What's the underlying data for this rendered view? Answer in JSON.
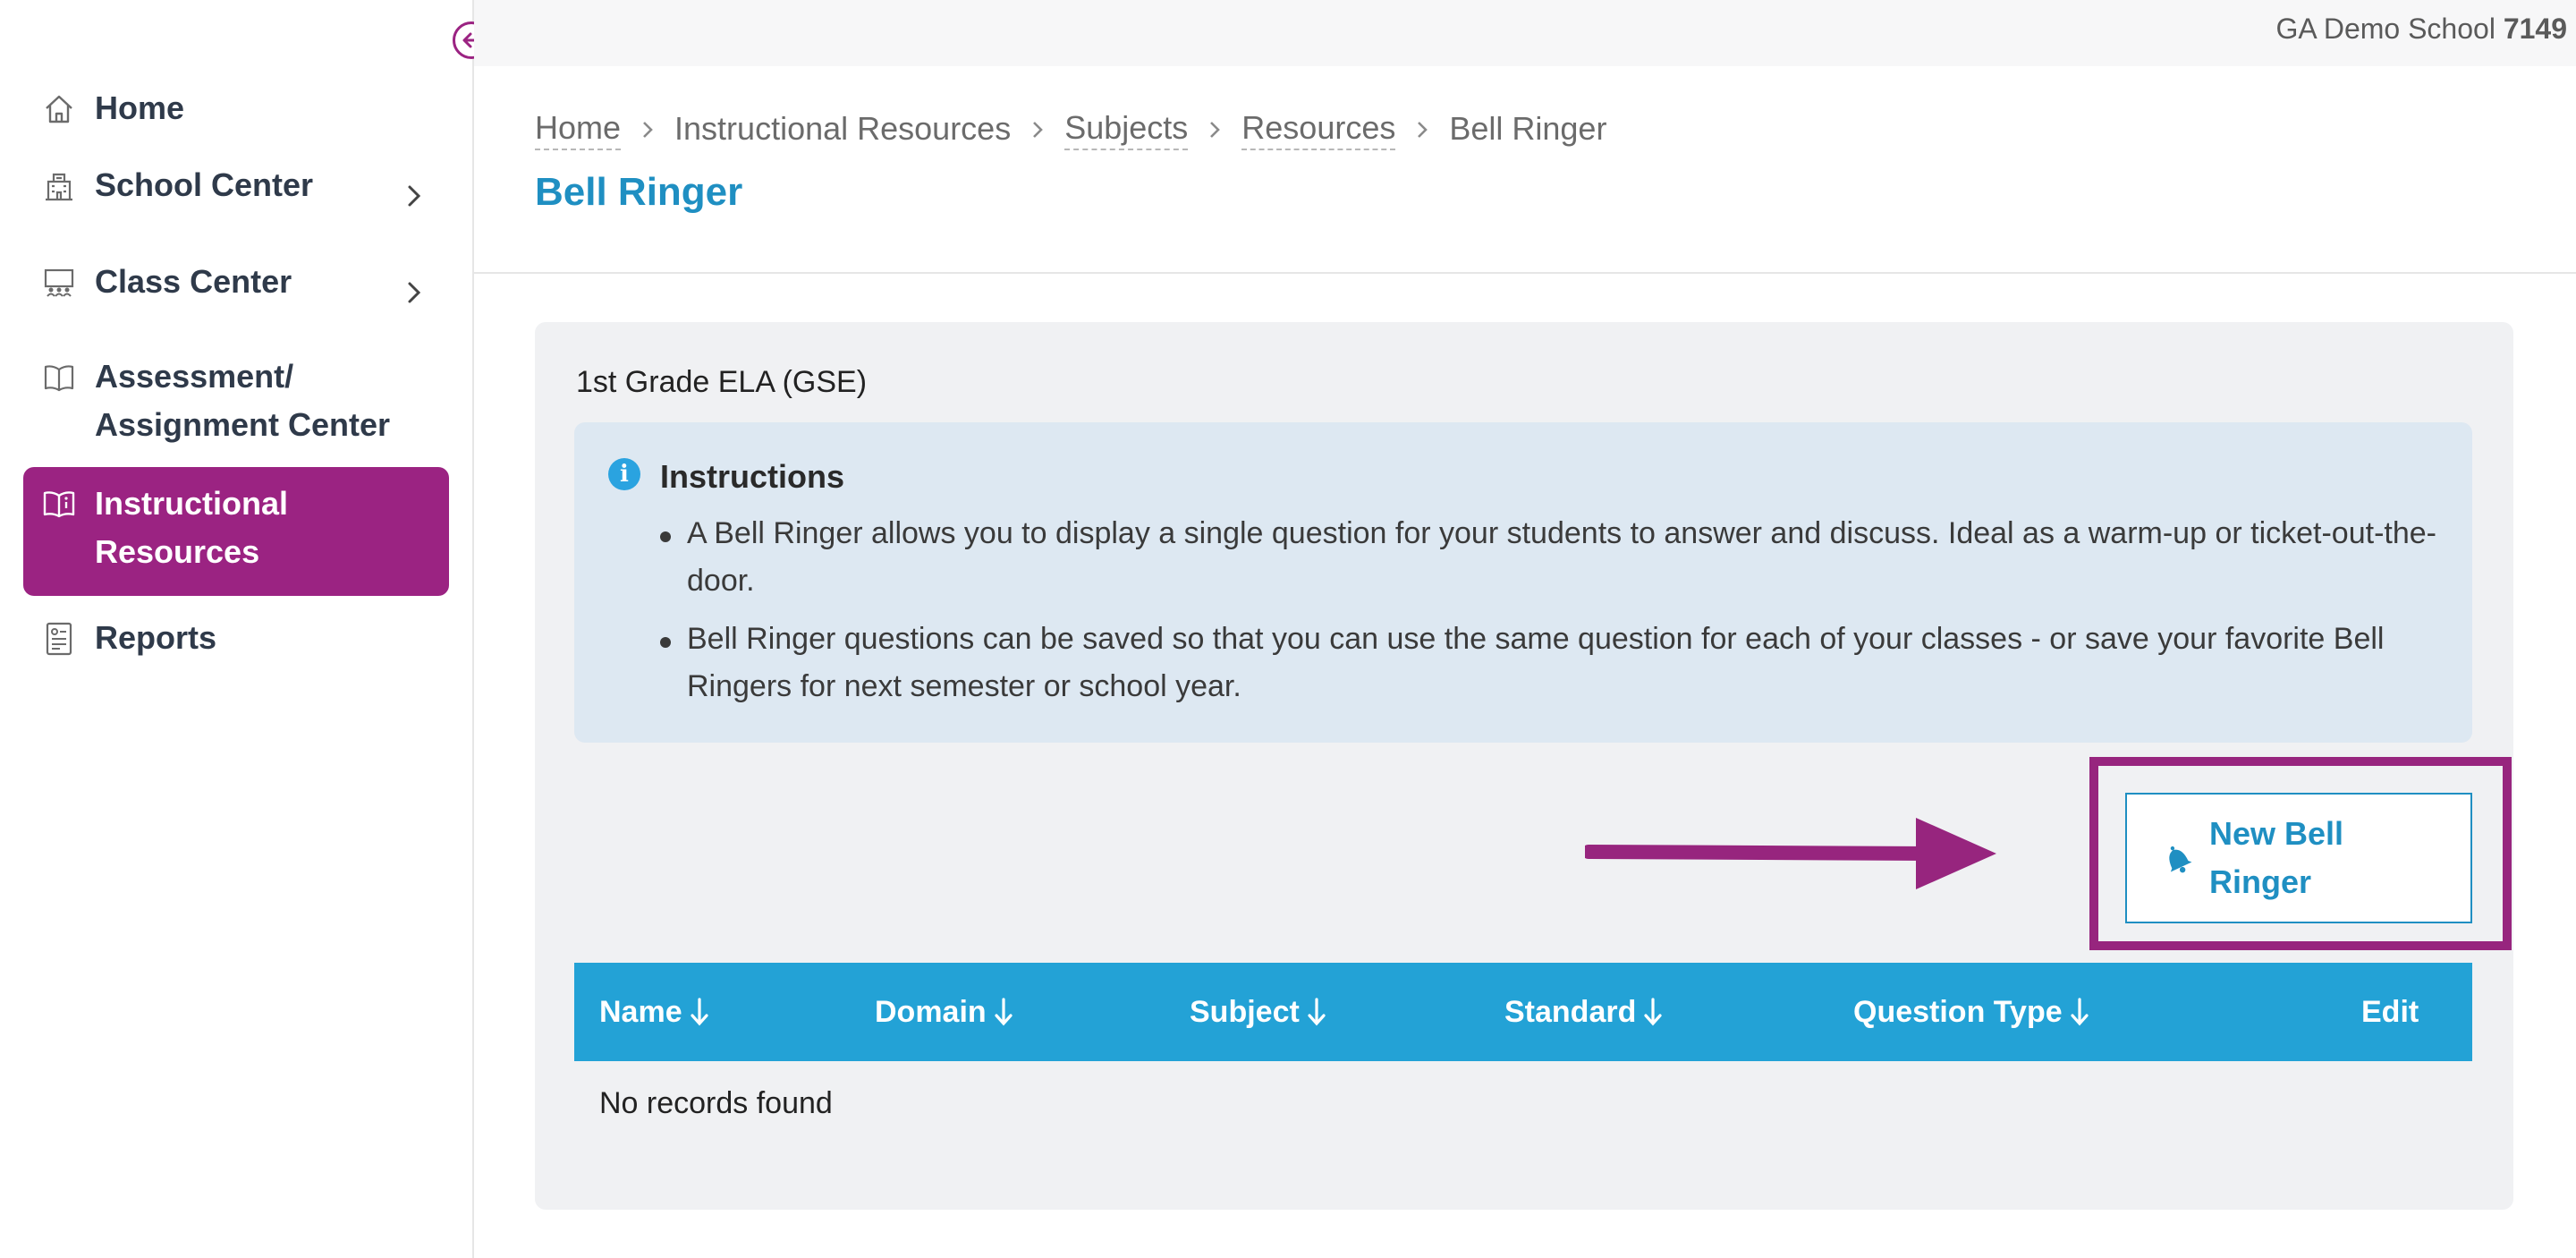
{
  "topbar": {
    "school_name": "GA Demo School",
    "school_id": "7149"
  },
  "sidebar": {
    "items": [
      {
        "label": "Home",
        "icon": "home-icon",
        "has_submenu": false,
        "active": false
      },
      {
        "label": "School Center",
        "icon": "school-building-icon",
        "has_submenu": true,
        "active": false
      },
      {
        "label": "Class Center",
        "icon": "classroom-icon",
        "has_submenu": true,
        "active": false
      },
      {
        "label": "Assessment/ Assignment Center",
        "icon": "open-book-icon",
        "has_submenu": false,
        "active": false
      },
      {
        "label": "Instructional Resources",
        "icon": "book-info-icon",
        "has_submenu": false,
        "active": true
      },
      {
        "label": "Reports",
        "icon": "report-document-icon",
        "has_submenu": false,
        "active": false
      }
    ]
  },
  "breadcrumb": [
    "Home",
    "Instructional Resources",
    "Subjects",
    "Resources",
    "Bell Ringer"
  ],
  "page": {
    "title": "Bell Ringer",
    "subject": "1st Grade ELA (GSE)"
  },
  "instructions": {
    "title": "Instructions",
    "items": [
      "A Bell Ringer allows you to display a single question for your students to answer and discuss. Ideal as a warm-up or ticket-out-the-door.",
      "Bell Ringer questions can be saved so that you can use the same question for each of your classes - or save your favorite Bell Ringers for next semester or school year."
    ]
  },
  "actions": {
    "new_bell_ringer": "New Bell Ringer"
  },
  "table": {
    "columns": [
      "Name",
      "Domain",
      "Subject",
      "Standard",
      "Question Type",
      "Edit"
    ],
    "empty_message": "No records found"
  },
  "colors": {
    "brand_purple": "#9b2382",
    "accent_blue": "#1f8fc2",
    "table_header": "#23a2d6",
    "info_bg": "#dde8f2"
  }
}
